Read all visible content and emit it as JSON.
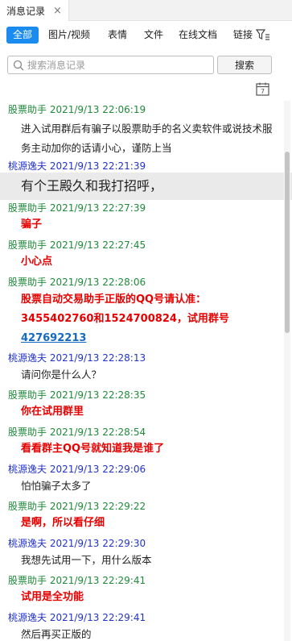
{
  "tab": {
    "title": "消息记录",
    "close": "×"
  },
  "filters": [
    "全部",
    "图片/视频",
    "表情",
    "文件",
    "在线文档",
    "链接"
  ],
  "search": {
    "placeholder": "搜索消息记录",
    "button": "搜索"
  },
  "colors": {
    "accent": "#1a8cf0",
    "sender_green": "#1f8a3a",
    "sender_blue": "#2233cc",
    "alert_red": "#e60000",
    "link": "#1469c2"
  },
  "messages": [
    {
      "sender": "股票助手",
      "time": "2021/9/13 22:06:19",
      "lines": [
        "进入试用群后有骗子以股票助手的名义卖软件或说技术服",
        "务主动加你的话请小心，谨防上当"
      ]
    },
    {
      "sender": "桃源逸夫",
      "time": "2021/9/13 22:21:39",
      "lines": [
        "有个王殿久和我打招呼，"
      ]
    },
    {
      "sender": "股票助手",
      "time": "2021/9/13 22:27:39",
      "lines": [
        "骗子"
      ]
    },
    {
      "sender": "股票助手",
      "time": "2021/9/13 22:27:45",
      "lines": [
        "小心点"
      ]
    },
    {
      "sender": "股票助手",
      "time": "2021/9/13 22:28:06",
      "lines": [
        "股票自动交易助手正版的QQ号请认准：",
        "3455402760和1524700824，试用群号"
      ],
      "link": "427692213"
    },
    {
      "sender": "桃源逸夫",
      "time": "2021/9/13 22:28:13",
      "lines": [
        "请问你是什么人？"
      ]
    },
    {
      "sender": "股票助手",
      "time": "2021/9/13 22:28:35",
      "lines": [
        "你在试用群里"
      ]
    },
    {
      "sender": "股票助手",
      "time": "2021/9/13 22:28:54",
      "lines": [
        "看看群主QQ号就知道我是谁了"
      ]
    },
    {
      "sender": "桃源逸夫",
      "time": "2021/9/13 22:29:06",
      "lines": [
        "怕怕骗子太多了"
      ]
    },
    {
      "sender": "股票助手",
      "time": "2021/9/13 22:29:22",
      "lines": [
        "是啊，所以看仔细"
      ]
    },
    {
      "sender": "桃源逸夫",
      "time": "2021/9/13 22:29:30",
      "lines": [
        "我想先试用一下，用什么版本"
      ]
    },
    {
      "sender": "股票助手",
      "time": "2021/9/13 22:29:41",
      "lines": [
        "试用是全功能"
      ]
    },
    {
      "sender": "桃源逸夫",
      "time": "2021/9/13 22:29:41",
      "lines": [
        "然后再买正版的"
      ]
    }
  ]
}
